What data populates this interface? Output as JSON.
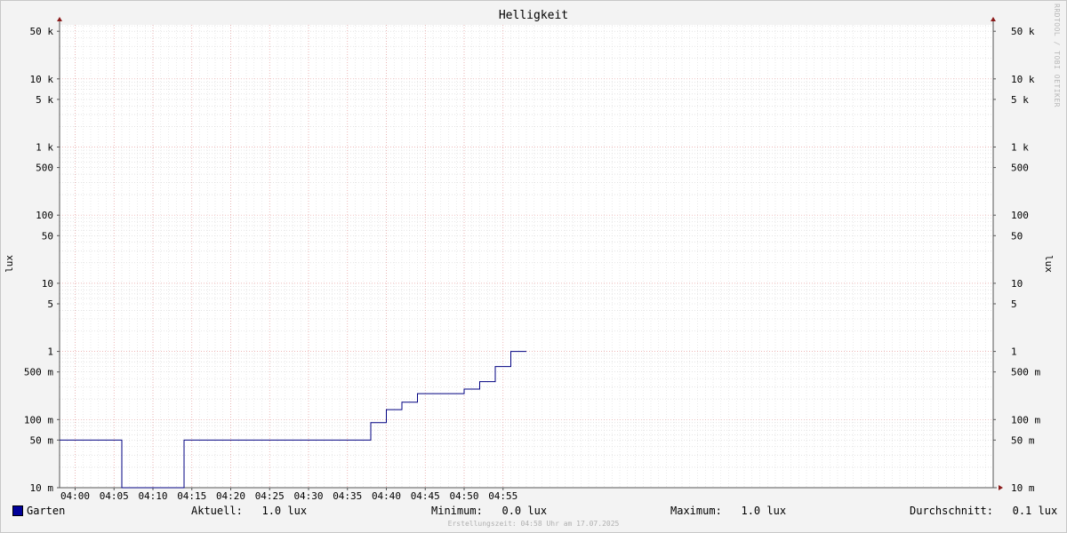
{
  "chart_data": {
    "type": "line",
    "title": "Helligkeit",
    "ylabel": "lux",
    "yscale": "log",
    "ylim": [
      10,
      70000
    ],
    "y_ticks": [
      {
        "value": 10,
        "label": "10 m"
      },
      {
        "value": 50,
        "label": "50 m"
      },
      {
        "value": 100,
        "label": "100 m"
      },
      {
        "value": 500,
        "label": "500 m"
      },
      {
        "value": 1000,
        "label": "1"
      },
      {
        "value": 5000,
        "label": "5"
      },
      {
        "value": 10000,
        "label": "10"
      },
      {
        "value": 50000,
        "label": "50"
      },
      {
        "value": 100000,
        "label": "100"
      },
      {
        "value": 500000,
        "label": "500"
      },
      {
        "value": 1000000,
        "label": "1 k"
      },
      {
        "value": 5000000,
        "label": "5 k"
      },
      {
        "value": 10000000,
        "label": "10 k"
      },
      {
        "value": 50000000,
        "label": "50 k"
      }
    ],
    "xlim": [
      "03:58",
      "05:58"
    ],
    "x_ticks": [
      "04:00",
      "04:05",
      "04:10",
      "04:15",
      "04:20",
      "04:25",
      "04:30",
      "04:35",
      "04:40",
      "04:45",
      "04:50",
      "04:55"
    ],
    "grid": true,
    "series": [
      {
        "name": "Garten",
        "color": "#000080",
        "step": true,
        "x": [
          "03:58",
          "04:06",
          "04:14",
          "04:38",
          "04:40",
          "04:42",
          "04:44",
          "04:50",
          "04:52",
          "04:54",
          "04:56",
          "04:58"
        ],
        "y": [
          50,
          10,
          50,
          90,
          140,
          180,
          240,
          280,
          360,
          600,
          1000,
          1000
        ]
      }
    ]
  },
  "watermark": "RRDTOOL / TOBI OETIKER",
  "legend": {
    "series_name": "Garten",
    "swatch_color": "#000099",
    "aktuell": "Aktuell:   1.0 lux",
    "minimum": "Minimum:   0.0 lux",
    "maximum": "Maximum:   1.0 lux",
    "durchschnitt": "Durchschnitt:   0.1 lux"
  },
  "footer": "Erstellungszeit: 04:58 Uhr am 17.07.2025"
}
